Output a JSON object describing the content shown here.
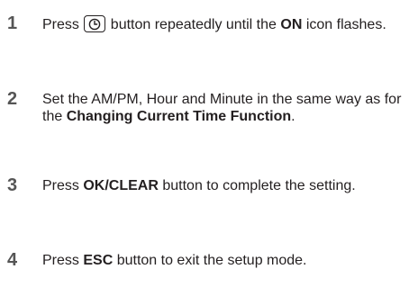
{
  "steps": [
    {
      "number": "1",
      "pre": "Press ",
      "icon": "clock-icon",
      "mid": " button repeatedly until the ",
      "bold": "ON",
      "post": " icon flashes."
    },
    {
      "number": "2",
      "pre": "Set the AM/PM, Hour and Minute in the same way as for the ",
      "bold": "Changing Current Time Function",
      "post": "."
    },
    {
      "number": "3",
      "pre": "Press ",
      "bold": "OK/CLEAR",
      "post": " button to complete the setting."
    },
    {
      "number": "4",
      "pre": "Press ",
      "bold": "ESC",
      "post": " button to exit the setup mode."
    }
  ]
}
